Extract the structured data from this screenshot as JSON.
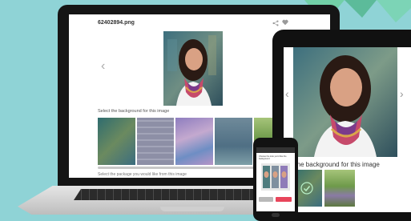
{
  "laptop": {
    "file_name": "62402894.png",
    "select_background_label": "Select the background for this image",
    "select_package_label": "Select the package you would like from this image"
  },
  "tablet": {
    "select_background_label": "t the background for this image"
  },
  "phone": {
    "header": "",
    "prompt": "Choose the look you'd like the background"
  },
  "colors": {
    "background": "#8fd3d6",
    "accent_pink": "#e8455b",
    "triangle_green": "#5cc39f"
  },
  "icons": [
    "share-icon",
    "heart-icon",
    "chevron-left-icon",
    "chevron-right-icon",
    "check-icon"
  ]
}
